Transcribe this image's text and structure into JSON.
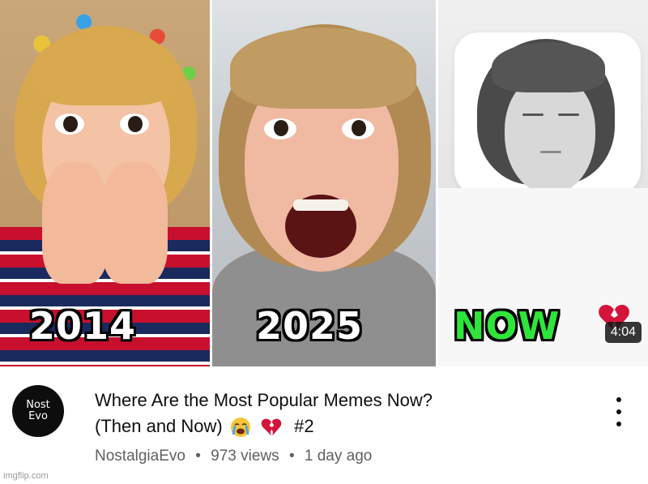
{
  "thumbnail": {
    "labels": [
      "2014",
      "2025",
      "NOW"
    ],
    "heart_icon": "broken-heart-icon",
    "duration": "4:04",
    "colors": {
      "now_label": "#2ee63a",
      "year_label": "#ffffff"
    }
  },
  "channel": {
    "avatar_line1": "Nost",
    "avatar_line2": "Evo",
    "name": "NostalgiaEvo"
  },
  "video": {
    "title_line1": "Where Are the Most Popular Memes Now?",
    "title_line2_text": "(Then and Now)",
    "title_line2_emojis": [
      "crying-face-icon",
      "broken-heart-icon"
    ],
    "title_line2_suffix": "#2",
    "views": "973 views",
    "age": "1 day ago"
  },
  "menu_icon": "more-vertical-icon",
  "watermark": "imgflip.com"
}
